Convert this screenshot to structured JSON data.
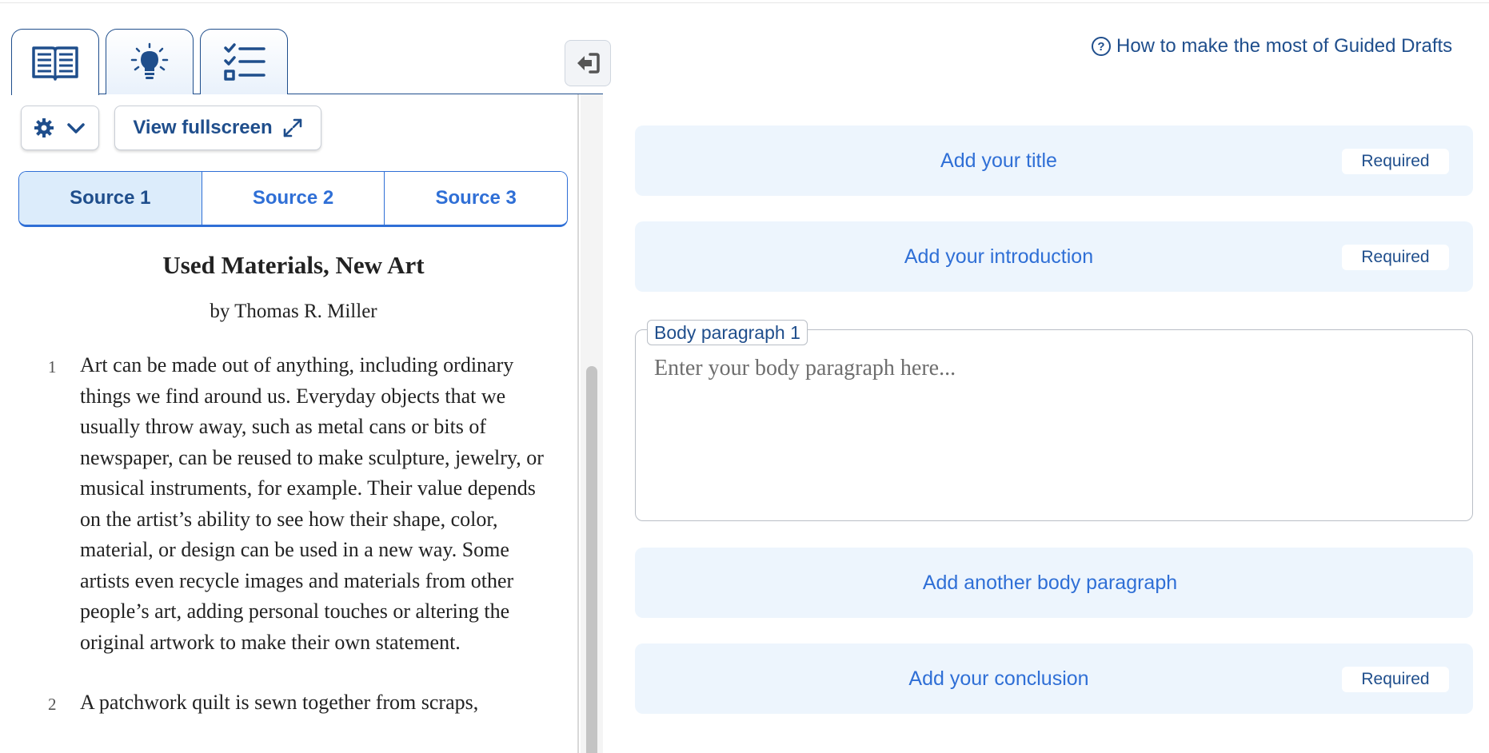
{
  "left_panel": {
    "tool_tabs": [
      {
        "name": "reading",
        "icon": "book-icon"
      },
      {
        "name": "ideas",
        "icon": "lightbulb-icon"
      },
      {
        "name": "checklist",
        "icon": "checklist-icon"
      }
    ],
    "collapse_icon": "collapse-panel-icon",
    "settings_icon": "gear-icon",
    "fullscreen_label": "View fullscreen",
    "sources": [
      {
        "label": "Source 1",
        "active": true
      },
      {
        "label": "Source 2",
        "active": false
      },
      {
        "label": "Source 3",
        "active": false
      }
    ],
    "article": {
      "title": "Used Materials, New Art",
      "byline": "by Thomas R. Miller",
      "paragraphs": [
        {
          "number": "1",
          "text": "Art can be made out of anything, including ordinary things we find around us. Everyday objects that we usually throw away, such as metal cans or bits of newspaper, can be reused to make sculpture, jewelry, or musical instruments, for example. Their value depends on the artist’s ability to see how their shape, color, material, or design can be used in a new way. Some artists even recycle images and materials from other people’s art, adding personal touches or altering the original artwork to make their own statement."
        },
        {
          "number": "2",
          "text": "A patchwork quilt is sewn together from scraps,"
        }
      ]
    }
  },
  "right_panel": {
    "help_link": "How to make the most of Guided Drafts",
    "sections": {
      "title": {
        "label": "Add your title",
        "badge": "Required"
      },
      "introduction": {
        "label": "Add your introduction",
        "badge": "Required"
      },
      "body_paragraph": {
        "legend": "Body paragraph 1",
        "placeholder": "Enter your body paragraph here...",
        "value": ""
      },
      "another_body": {
        "label": "Add another body paragraph"
      },
      "conclusion": {
        "label": "Add your conclusion",
        "badge": "Required"
      }
    }
  },
  "colors": {
    "navy": "#1f4e8c",
    "link_blue": "#2f6fd6",
    "card_bg": "#edf5fd",
    "active_tab_bg": "#dcecfb"
  }
}
